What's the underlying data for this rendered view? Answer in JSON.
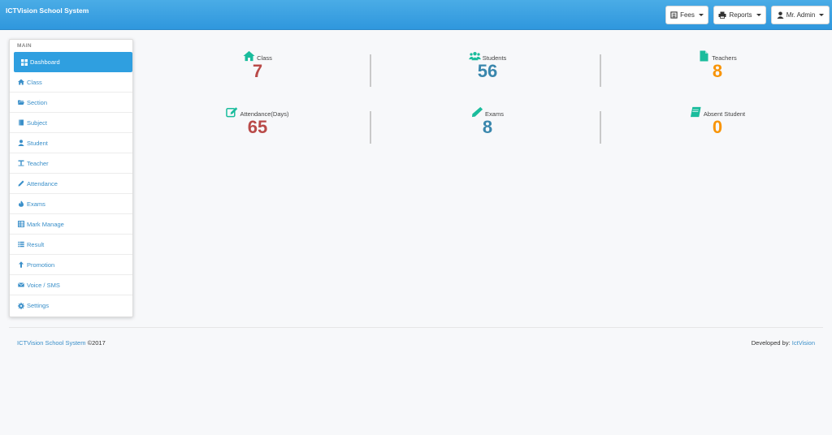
{
  "app": {
    "brand": "ICTVision School System"
  },
  "topnav": {
    "fees": "Fees",
    "reports": "Reports",
    "user": "Mr. Admin"
  },
  "sidebar": {
    "header": "MAIN",
    "items": [
      {
        "label": "Dashboard",
        "icon": "dashboard-icon"
      },
      {
        "label": "Class",
        "icon": "home-icon"
      },
      {
        "label": "Section",
        "icon": "folder-open-icon"
      },
      {
        "label": "Subject",
        "icon": "book-icon"
      },
      {
        "label": "Student",
        "icon": "user-icon"
      },
      {
        "label": "Teacher",
        "icon": "text-height-icon"
      },
      {
        "label": "Attendance",
        "icon": "pencil-icon"
      },
      {
        "label": "Exams",
        "icon": "fire-icon"
      },
      {
        "label": "Mark Manage",
        "icon": "table-icon"
      },
      {
        "label": "Result",
        "icon": "list-icon"
      },
      {
        "label": "Promotion",
        "icon": "arrow-up-icon"
      },
      {
        "label": "Voice / SMS",
        "icon": "envelope-icon"
      },
      {
        "label": "Settings",
        "icon": "gear-icon"
      }
    ]
  },
  "stats": [
    {
      "label": "Class",
      "value": "7",
      "icon": "home-icon"
    },
    {
      "label": "Students",
      "value": "56",
      "icon": "users-icon"
    },
    {
      "label": "Teachers",
      "value": "8",
      "icon": "file-icon"
    },
    {
      "label": "Attendance(Days)",
      "value": "65",
      "icon": "edit-icon"
    },
    {
      "label": "Exams",
      "value": "8",
      "icon": "pencil-icon"
    },
    {
      "label": "Absent Student",
      "value": "0",
      "icon": "book-icon"
    }
  ],
  "colors": {
    "topbar": "#3aa0e0",
    "red": "#b94a48",
    "blue": "#3a87ad",
    "orange": "#f89406",
    "teal": "#1abc9c"
  },
  "footer": {
    "left_link": "ICTVision School System",
    "left_suffix": " ©2017",
    "right_prefix": "Developed by: ",
    "right_link": "IctVision"
  }
}
